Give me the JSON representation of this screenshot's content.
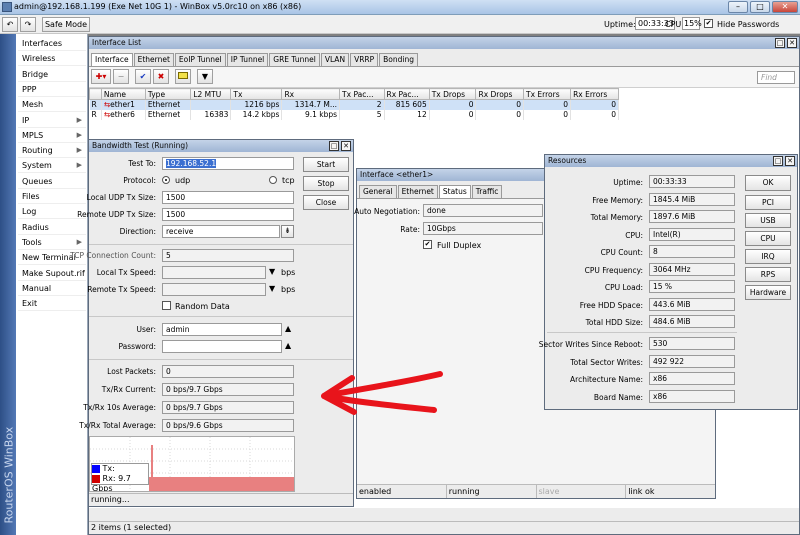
{
  "window": {
    "title": "admin@192.168.1.199 (Exe Net 10G 1) - WinBox v5.0rc10 on x86 (x86)"
  },
  "toolbar": {
    "undo": "↶",
    "redo": "↷",
    "safe_mode": "Safe Mode",
    "uptime_label": "Uptime:",
    "uptime_value": "00:33:33",
    "cpu_label": "CPU:",
    "cpu_value": "15%",
    "hide_passwords": "Hide Passwords"
  },
  "sidebar": {
    "brand": "RouterOS WinBox",
    "items": [
      {
        "label": "Interfaces",
        "arrow": ""
      },
      {
        "label": "Wireless",
        "arrow": ""
      },
      {
        "label": "Bridge",
        "arrow": ""
      },
      {
        "label": "PPP",
        "arrow": ""
      },
      {
        "label": "Mesh",
        "arrow": ""
      },
      {
        "label": "IP",
        "arrow": "▶"
      },
      {
        "label": "MPLS",
        "arrow": "▶"
      },
      {
        "label": "Routing",
        "arrow": "▶"
      },
      {
        "label": "System",
        "arrow": "▶"
      },
      {
        "label": "Queues",
        "arrow": ""
      },
      {
        "label": "Files",
        "arrow": ""
      },
      {
        "label": "Log",
        "arrow": ""
      },
      {
        "label": "Radius",
        "arrow": ""
      },
      {
        "label": "Tools",
        "arrow": "▶"
      },
      {
        "label": "New Terminal",
        "arrow": ""
      },
      {
        "label": "Make Supout.rif",
        "arrow": ""
      },
      {
        "label": "Manual",
        "arrow": ""
      },
      {
        "label": "Exit",
        "arrow": ""
      }
    ]
  },
  "interface_list": {
    "title": "Interface List",
    "tabs": [
      "Interface",
      "Ethernet",
      "EoIP Tunnel",
      "IP Tunnel",
      "GRE Tunnel",
      "VLAN",
      "VRRP",
      "Bonding"
    ],
    "find_placeholder": "Find",
    "columns": [
      "Name",
      "Type",
      "L2 MTU",
      "Tx",
      "Rx",
      "Tx Pac...",
      "Rx Pac...",
      "Tx Drops",
      "Rx Drops",
      "Tx Errors",
      "Rx Errors"
    ],
    "rows": [
      {
        "flag": "R",
        "name": "ether1",
        "type": "Ethernet",
        "l2mtu": "",
        "tx": "1216 bps",
        "rx": "1314.7 M...",
        "txp": "2",
        "rxp": "815 605",
        "txd": "0",
        "rxd": "0",
        "txe": "0",
        "rxe": "0"
      },
      {
        "flag": "R",
        "name": "ether6",
        "type": "Ethernet",
        "l2mtu": "16383",
        "tx": "14.2 kbps",
        "rx": "9.1 kbps",
        "txp": "5",
        "rxp": "12",
        "txd": "0",
        "rxd": "0",
        "txe": "0",
        "rxe": "0"
      }
    ],
    "status": "2 items (1 selected)"
  },
  "bandwidth_test": {
    "title": "Bandwidth Test (Running)",
    "test_to_label": "Test To:",
    "test_to": "192.168.52.1",
    "protocol_label": "Protocol:",
    "protocol_udp": "udp",
    "protocol_tcp": "tcp",
    "local_udp_label": "Local UDP Tx Size:",
    "local_udp": "1500",
    "remote_udp_label": "Remote UDP Tx Size:",
    "remote_udp": "1500",
    "direction_label": "Direction:",
    "direction": "receive",
    "tcp_conn_label": "TCP Connection Count:",
    "tcp_conn": "5",
    "local_speed_label": "Local Tx Speed:",
    "remote_speed_label": "Remote Tx Speed:",
    "bps_unit": "bps",
    "random_data": "Random Data",
    "user_label": "User:",
    "user": "admin",
    "password_label": "Password:",
    "lost_packets_label": "Lost Packets:",
    "lost_packets": "0",
    "current_label": "Tx/Rx Current:",
    "current": "0 bps/9.7 Gbps",
    "avg10_label": "Tx/Rx 10s Average:",
    "avg10": "0 bps/9.7 Gbps",
    "total_avg_label": "Tx/Rx Total Average:",
    "total_avg": "0 bps/9.6 Gbps",
    "start": "Start",
    "stop": "Stop",
    "close": "Close",
    "legend_tx": "Tx:",
    "legend_rx": "Rx:  9.7 Gbps",
    "status": "running...",
    "tx_color": "#0000ff",
    "rx_color": "#d00000"
  },
  "iface_ether1": {
    "title": "Interface <ether1>",
    "tabs": [
      "General",
      "Ethernet",
      "Status",
      "Traffic"
    ],
    "auto_neg_label": "Auto Negotiation:",
    "auto_neg": "done",
    "rate_label": "Rate:",
    "rate": "10Gbps",
    "full_duplex": "Full Duplex",
    "status_cells": [
      "enabled",
      "running",
      "slave",
      "link ok"
    ]
  },
  "resources": {
    "title": "Resources",
    "rows": [
      {
        "label": "Uptime:",
        "value": "00:33:33"
      },
      {
        "label": "Free Memory:",
        "value": "1845.4 MiB"
      },
      {
        "label": "Total Memory:",
        "value": "1897.6 MiB"
      },
      {
        "label": "CPU:",
        "value": "Intel(R)"
      },
      {
        "label": "CPU Count:",
        "value": "8"
      },
      {
        "label": "CPU Frequency:",
        "value": "3064 MHz"
      },
      {
        "label": "CPU Load:",
        "value": "15 %"
      },
      {
        "label": "Free HDD Space:",
        "value": "443.6 MiB"
      },
      {
        "label": "Total HDD Size:",
        "value": "484.6 MiB"
      }
    ],
    "rows2": [
      {
        "label": "Sector Writes Since Reboot:",
        "value": "530"
      },
      {
        "label": "Total Sector Writes:",
        "value": "492 922"
      },
      {
        "label": "Architecture Name:",
        "value": "x86"
      },
      {
        "label": "Board Name:",
        "value": "x86"
      }
    ],
    "buttons": [
      "OK",
      "PCI",
      "USB",
      "CPU",
      "IRQ",
      "RPS",
      "Hardware"
    ]
  },
  "annotation": {
    "arrow_color": "#e8141b"
  }
}
